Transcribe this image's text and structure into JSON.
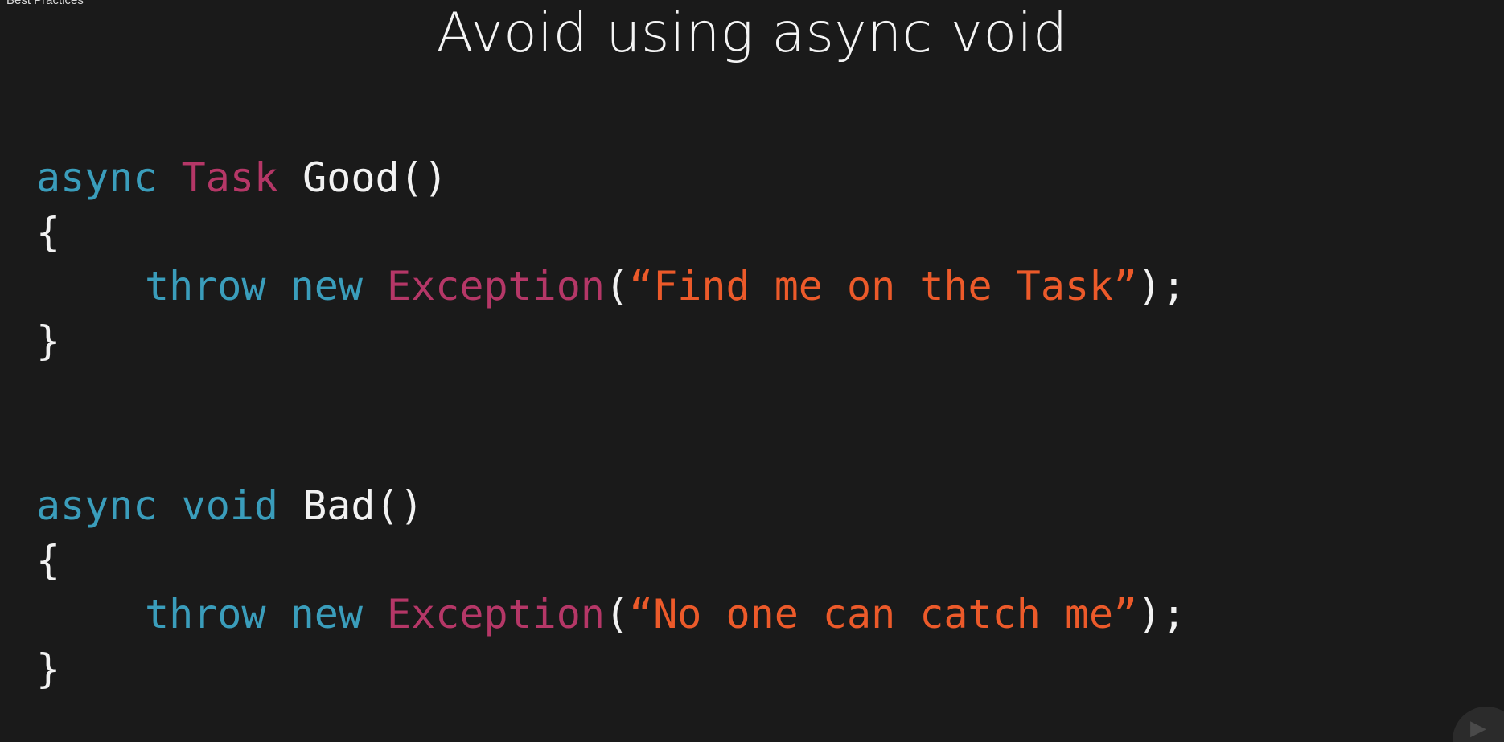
{
  "header": {
    "breadcrumb": "Best Practices"
  },
  "slide": {
    "title": "Avoid using async void",
    "good_example": {
      "kw1": "async",
      "type": "Task",
      "name": "Good()",
      "open_brace": "{",
      "throw_kw": "throw",
      "new_kw": "new",
      "exception_type": "Exception",
      "paren_open": "(",
      "message": "“Find me on the Task”",
      "paren_close": ");",
      "close_brace": "}"
    },
    "bad_example": {
      "kw1": "async",
      "kw2": "void",
      "name": "Bad()",
      "open_brace": "{",
      "throw_kw": "throw",
      "new_kw": "new",
      "exception_type": "Exception",
      "paren_open": "(",
      "message": "“No one can catch me”",
      "paren_close": ");",
      "close_brace": "}"
    }
  },
  "colors": {
    "background": "#1a1a1a",
    "keyword": "#3a9dbb",
    "type": "#b53767",
    "string": "#ec5a2a",
    "text": "#f2f2f2"
  },
  "icons": {
    "corner": "player-logo-icon"
  }
}
